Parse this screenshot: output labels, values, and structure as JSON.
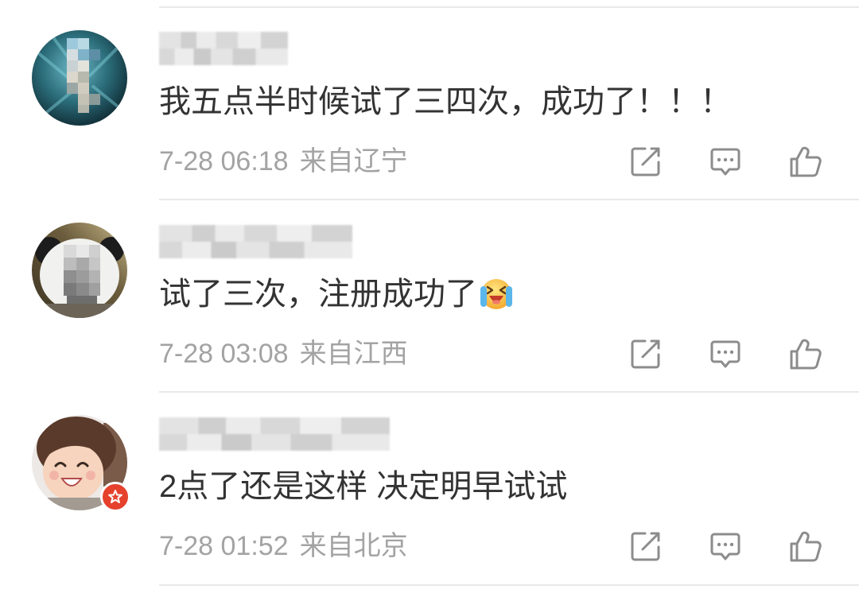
{
  "colors": {
    "text": "#333333",
    "meta": "#a3a3a3",
    "icon": "#8c8c8c",
    "divider": "#e9e9e9",
    "badge": "#e5412d"
  },
  "actions": {
    "repost_icon": "repost-icon",
    "comment_icon": "comment-icon",
    "like_icon": "thumbs-up-icon"
  },
  "comments": [
    {
      "text": "我五点半时候试了三四次，成功了！！！",
      "time": "7-28 06:18",
      "source": "来自辽宁"
    },
    {
      "text": "试了三次，注册成功了",
      "emoji": "laughing-with-tears-emoji",
      "time": "7-28 03:08",
      "source": "来自江西"
    },
    {
      "text": "2点了还是这样 决定明早试试",
      "badge": "verified-star-badge",
      "time": "7-28 01:52",
      "source": "来自北京"
    }
  ]
}
